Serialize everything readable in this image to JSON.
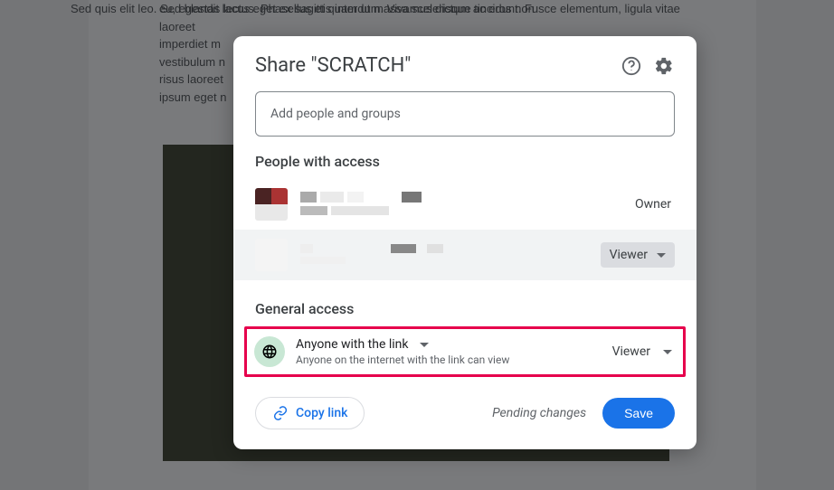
{
  "background_doc": {
    "para_top": "eu, egestas lectus. Phasellus et quam ut massa scelerisque tincidunt. Fusce elementum, ligula vitae laoreet",
    "para_top_2": "imperdiet m",
    "para_top_3": "vestibulum n",
    "para_top_4": "risus laoreet",
    "para_top_5": "ipsum eget n",
    "para_bottom": "Sed quis elit leo. Sed blandit lacus eget ex sagittis interdum. Vivamus dictum ac eros non"
  },
  "dialog": {
    "title": "Share \"SCRATCH\"",
    "add_placeholder": "Add people and groups",
    "sections": {
      "people": "People with access",
      "general": "General access"
    },
    "people": [
      {
        "role": "Owner"
      },
      {
        "role": "Viewer"
      }
    ],
    "general_access": {
      "scope": "Anyone with the link",
      "description": "Anyone on the internet with the link can view",
      "role": "Viewer"
    },
    "footer": {
      "copy_link": "Copy link",
      "pending": "Pending changes",
      "save": "Save"
    }
  }
}
